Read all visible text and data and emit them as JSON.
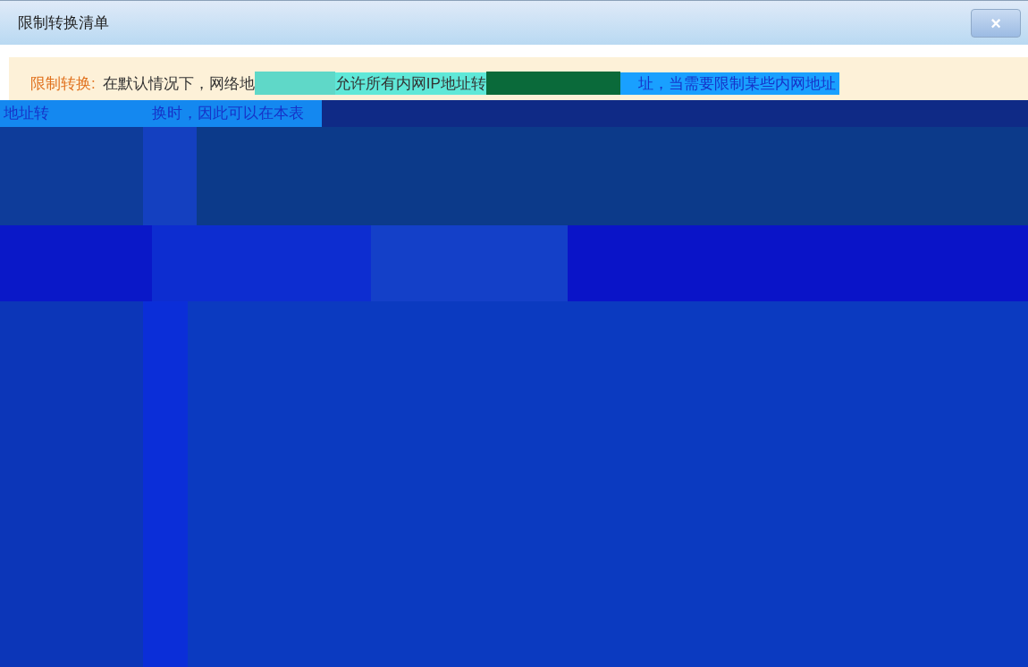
{
  "window": {
    "title": "限制转换清单",
    "close": "×"
  },
  "notice": {
    "label": "限制转换:",
    "fragments": [
      "在默认情况下，网络地",
      "允许所有内网IP地址转",
      "址，当需要限制某些内网地址"
    ]
  },
  "second_line": [
    "地址转",
    "换时，因此可以在本表"
  ]
}
